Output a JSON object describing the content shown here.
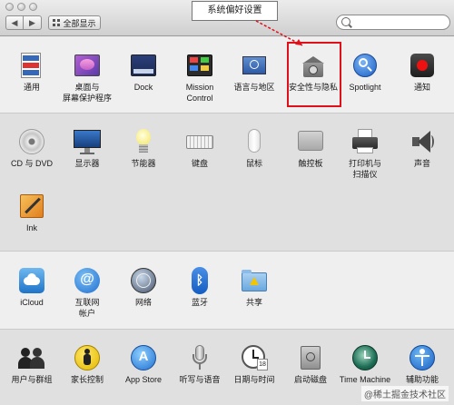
{
  "window": {
    "title_callout": "系统偏好设置",
    "show_all_label": "全部显示",
    "search_placeholder": ""
  },
  "rows": [
    {
      "items": [
        {
          "label": "通用",
          "icon": "general-icon"
        },
        {
          "label": "桌面与\n屏幕保护程序",
          "icon": "desktop-icon"
        },
        {
          "label": "Dock",
          "icon": "dock-icon"
        },
        {
          "label": "Mission\nControl",
          "icon": "mission-control-icon"
        },
        {
          "label": "语言与地区",
          "icon": "language-icon"
        },
        {
          "label": "安全性与隐私",
          "icon": "security-icon"
        },
        {
          "label": "Spotlight",
          "icon": "spotlight-icon"
        },
        {
          "label": "通知",
          "icon": "notifications-icon"
        }
      ]
    },
    {
      "items": [
        {
          "label": "CD 与 DVD",
          "icon": "cd-dvd-icon"
        },
        {
          "label": "显示器",
          "icon": "displays-icon"
        },
        {
          "label": "节能器",
          "icon": "energy-saver-icon"
        },
        {
          "label": "键盘",
          "icon": "keyboard-icon"
        },
        {
          "label": "鼠标",
          "icon": "mouse-icon"
        },
        {
          "label": "触控板",
          "icon": "trackpad-icon"
        },
        {
          "label": "打印机与\n扫描仪",
          "icon": "printer-icon"
        },
        {
          "label": "声音",
          "icon": "sound-icon"
        },
        {
          "label": "Ink",
          "icon": "ink-icon"
        }
      ]
    },
    {
      "items": [
        {
          "label": "iCloud",
          "icon": "icloud-icon"
        },
        {
          "label": "互联网\n帐户",
          "icon": "internet-accounts-icon"
        },
        {
          "label": "网络",
          "icon": "network-icon"
        },
        {
          "label": "蓝牙",
          "icon": "bluetooth-icon"
        },
        {
          "label": "共享",
          "icon": "sharing-icon"
        }
      ]
    },
    {
      "items": [
        {
          "label": "用户与群组",
          "icon": "users-icon"
        },
        {
          "label": "家长控制",
          "icon": "parental-controls-icon"
        },
        {
          "label": "App Store",
          "icon": "app-store-icon"
        },
        {
          "label": "听写与语音",
          "icon": "dictation-icon"
        },
        {
          "label": "日期与时间",
          "icon": "date-time-icon"
        },
        {
          "label": "启动磁盘",
          "icon": "startup-disk-icon"
        },
        {
          "label": "Time Machine",
          "icon": "time-machine-icon"
        },
        {
          "label": "辅助功能",
          "icon": "accessibility-icon"
        }
      ]
    }
  ],
  "watermark": "@稀土掘金技术社区"
}
